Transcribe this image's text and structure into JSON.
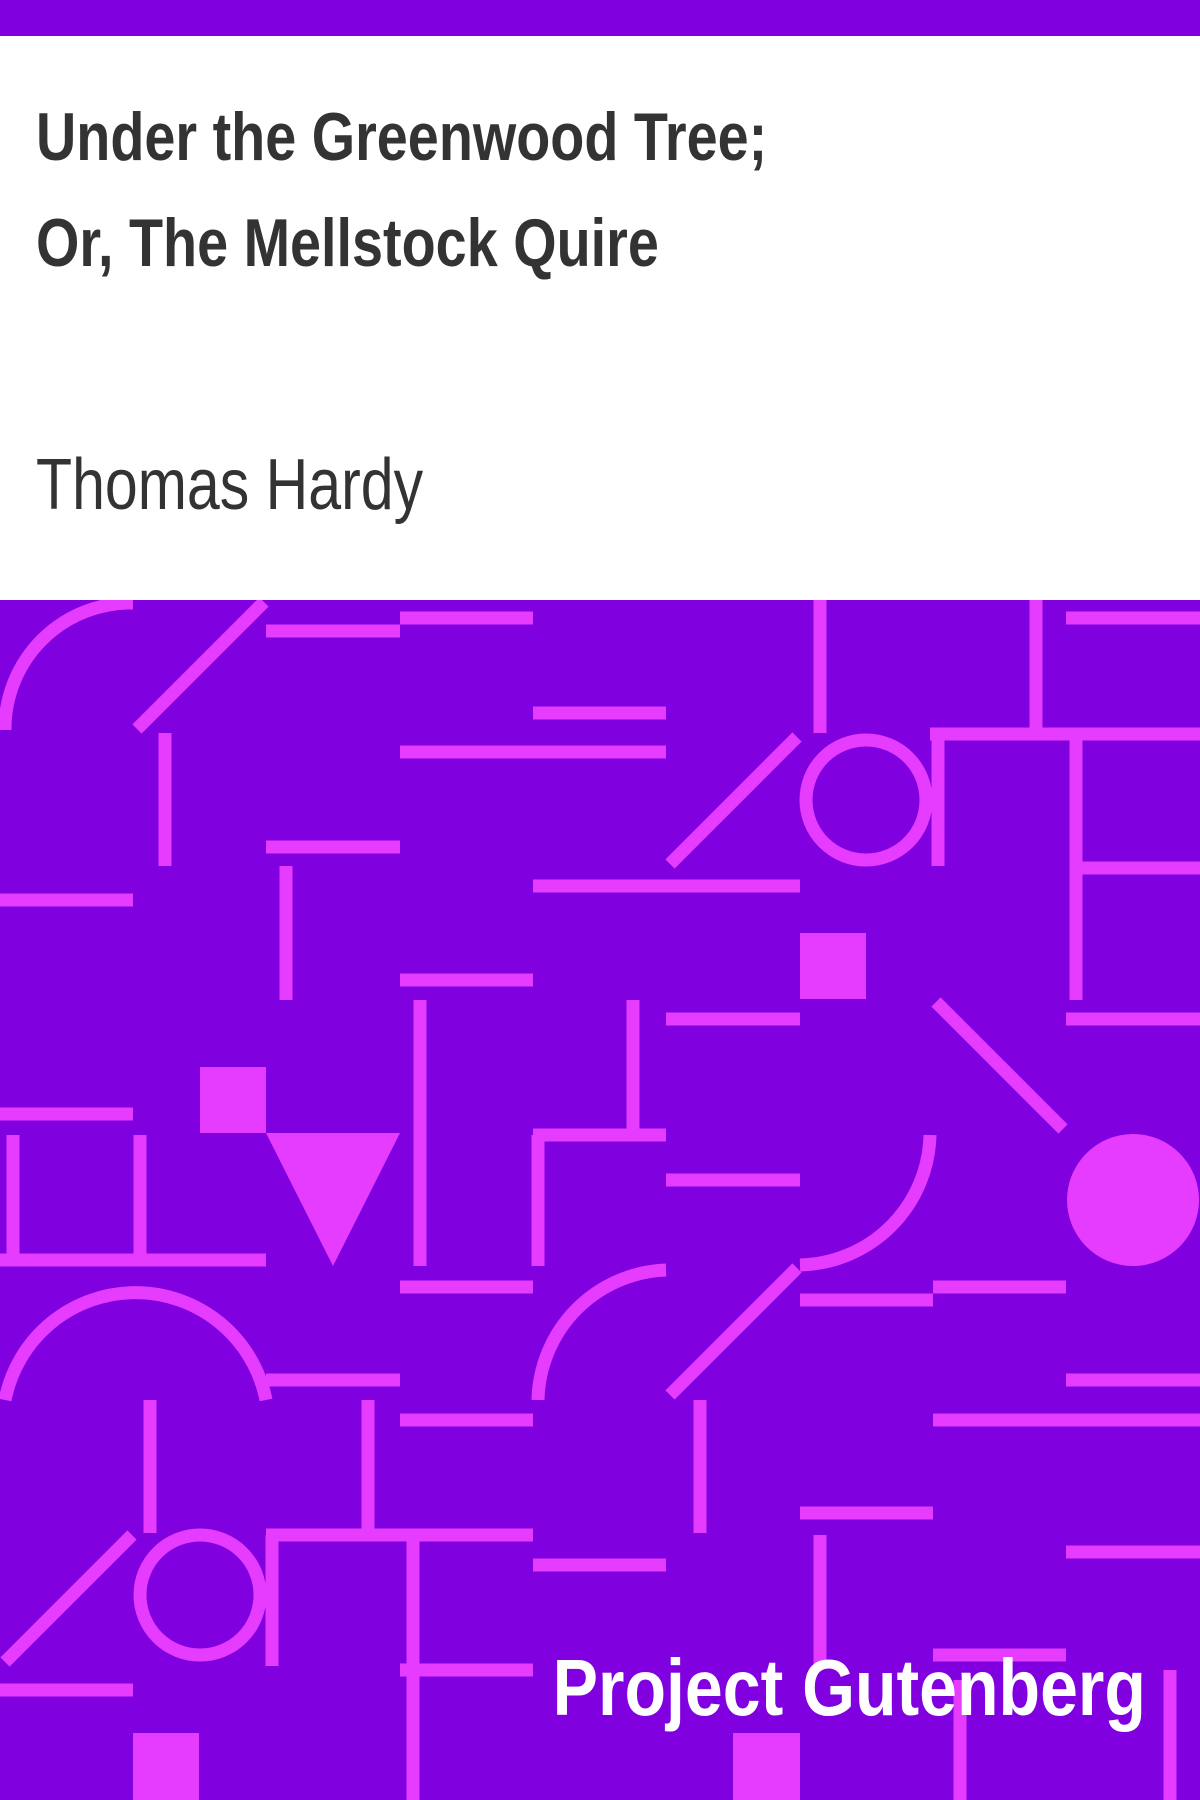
{
  "book": {
    "title": "Under the Greenwood Tree; Or, The Mellstock Quire",
    "author": "Thomas Hardy",
    "publisher": "Project Gutenberg"
  },
  "colors": {
    "background_purple": "#8000e0",
    "pattern_pink": "#e63cff",
    "text_dark": "#333333",
    "text_light": "#ffffff",
    "page_white": "#ffffff"
  }
}
